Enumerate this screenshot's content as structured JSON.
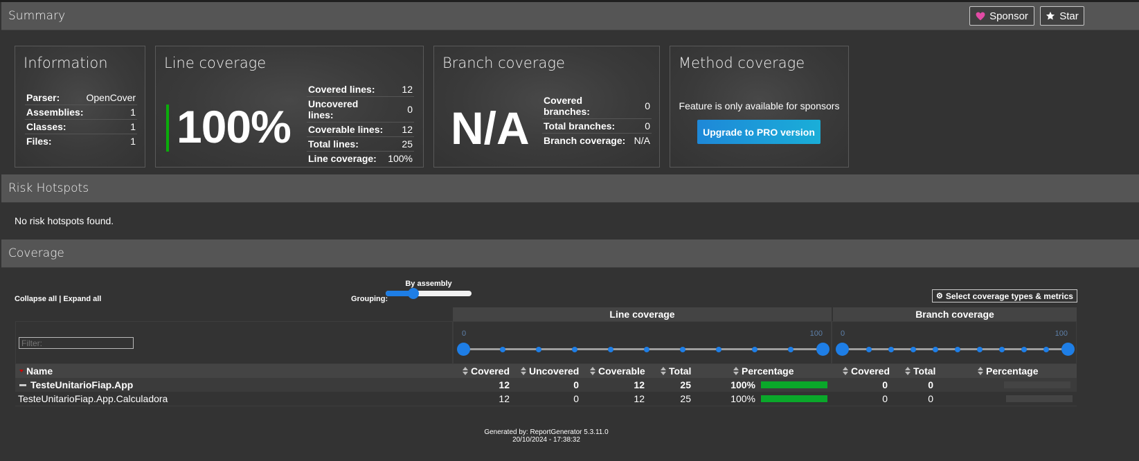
{
  "summary": {
    "title": "Summary",
    "sponsor_label": "Sponsor",
    "star_label": "Star"
  },
  "information": {
    "title": "Information",
    "rows": [
      {
        "label": "Parser:",
        "value": "OpenCover"
      },
      {
        "label": "Assemblies:",
        "value": "1"
      },
      {
        "label": "Classes:",
        "value": "1"
      },
      {
        "label": "Files:",
        "value": "1"
      }
    ]
  },
  "line_coverage_card": {
    "title": "Line coverage",
    "big_value": "100%",
    "accent_color": "#0aad0a",
    "rows": [
      {
        "label": "Covered lines:",
        "value": "12"
      },
      {
        "label": "Uncovered lines:",
        "value": "0"
      },
      {
        "label": "Coverable lines:",
        "value": "12"
      },
      {
        "label": "Total lines:",
        "value": "25"
      },
      {
        "label": "Line coverage:",
        "value": "100%"
      }
    ]
  },
  "branch_coverage_card": {
    "title": "Branch coverage",
    "big_value": "N/A",
    "rows": [
      {
        "label": "Covered branches:",
        "value": "0"
      },
      {
        "label": "Total branches:",
        "value": "0"
      },
      {
        "label": "Branch coverage:",
        "value": "N/A"
      }
    ]
  },
  "method_coverage_card": {
    "title": "Method coverage",
    "message": "Feature is only available for sponsors",
    "button_label": "Upgrade to PRO version"
  },
  "risk_hotspots": {
    "title": "Risk Hotspots",
    "message": "No risk hotspots found."
  },
  "coverage": {
    "title": "Coverage",
    "collapse_all": "Collapse all",
    "separator": "|",
    "expand_all": "Expand all",
    "grouping_label": "Grouping:",
    "grouping_value": "By assembly",
    "grouping_level": 0.3,
    "select_types_label": "Select coverage types & metrics",
    "filter_placeholder": "Filter:",
    "line_group_title": "Line coverage",
    "branch_group_title": "Branch coverage",
    "line_range": {
      "min": "0",
      "max": "100"
    },
    "branch_range": {
      "min": "0",
      "max": "100"
    },
    "columns": {
      "name": "Name",
      "covered": "Covered",
      "uncovered": "Uncovered",
      "coverable": "Coverable",
      "total": "Total",
      "percentage": "Percentage",
      "b_covered": "Covered",
      "b_total": "Total",
      "b_percentage": "Percentage"
    },
    "rows": [
      {
        "name": "TesteUnitarioFiap.App",
        "covered": "12",
        "uncovered": "0",
        "coverable": "12",
        "total": "25",
        "percentage": "100%",
        "line_fraction": 1.0,
        "b_covered": "0",
        "b_total": "0",
        "b_percentage": ""
      },
      {
        "name": "TesteUnitarioFiap.App.Calculadora",
        "covered": "12",
        "uncovered": "0",
        "coverable": "12",
        "total": "25",
        "percentage": "100%",
        "line_fraction": 1.0,
        "b_covered": "0",
        "b_total": "0",
        "b_percentage": ""
      }
    ]
  },
  "footer": {
    "generated_by": "Generated by: ReportGenerator 5.3.11.0",
    "date": "20/10/2024 - 17:38:32"
  },
  "colors": {
    "bar_green": "#0aa82a",
    "bar_empty": "#444444",
    "accent_blue": "#1e7ee6"
  }
}
